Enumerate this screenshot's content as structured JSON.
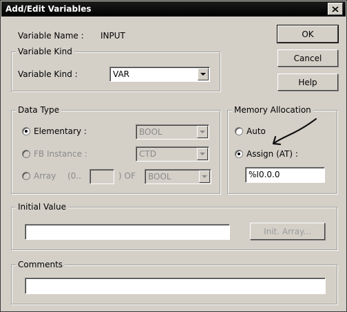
{
  "window": {
    "title": "Add/Edit Variables"
  },
  "buttons": {
    "ok": "OK",
    "cancel": "Cancel",
    "help": "Help",
    "init_array": "Init. Array..."
  },
  "variable_name": {
    "label": "Variable Name :",
    "value": "INPUT"
  },
  "variable_kind": {
    "group_title": "Variable Kind",
    "label": "Variable Kind :",
    "value": "VAR"
  },
  "data_type": {
    "group_title": "Data Type",
    "elementary": {
      "label": "Elementary :",
      "value": "BOOL",
      "selected": true
    },
    "fb_instance": {
      "label": "FB Instance :",
      "value": "CTD",
      "selected": false
    },
    "array": {
      "label": "Array",
      "range_open": "(0..",
      "range_value": "",
      "of_label": ") OF",
      "value": "BOOL",
      "selected": false
    }
  },
  "memory_allocation": {
    "group_title": "Memory Allocation",
    "auto": {
      "label": "Auto",
      "selected": false
    },
    "assign": {
      "label": "Assign (AT) :",
      "selected": true,
      "value": "%I0.0.0"
    }
  },
  "initial_value": {
    "group_title": "Initial Value",
    "value": ""
  },
  "comments": {
    "group_title": "Comments",
    "value": ""
  },
  "icons": [
    "close-icon",
    "chevron-down-icon",
    "arrow-annotation"
  ]
}
